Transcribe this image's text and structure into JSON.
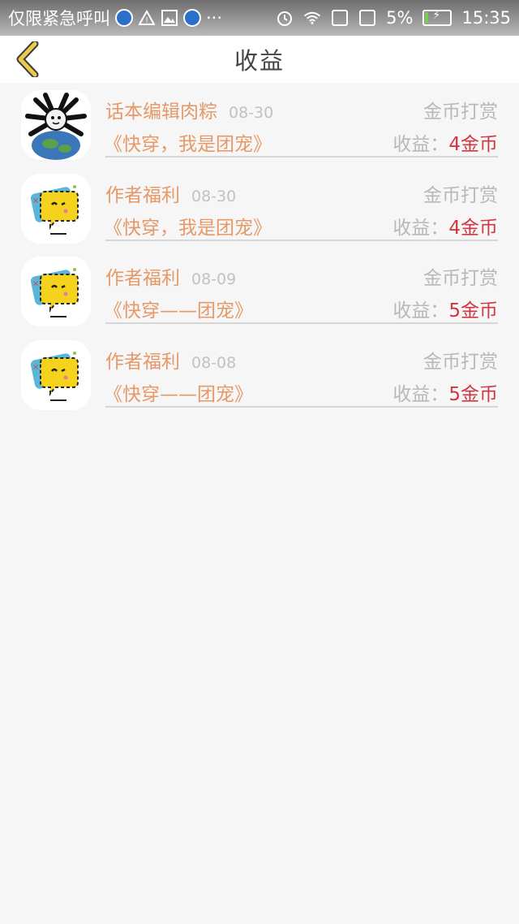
{
  "status_bar": {
    "notification_text": "仅限紧急呼叫",
    "battery_percent": "5%",
    "time": "15:35",
    "more_dots": "···"
  },
  "header": {
    "title": "收益",
    "back_icon": "chevron-left-icon"
  },
  "colors": {
    "accent_orange": "#e69968",
    "earn_red": "#cf3742",
    "muted_gray": "#b8b8b8",
    "back_yellow": "#e8c63a"
  },
  "earnings": [
    {
      "avatar": "spider-meme-avatar",
      "author": "话本编辑肉粽",
      "date": "08-30",
      "type": "金币打赏",
      "book": "《快穿，我是团宠》",
      "earn_label": "收益：",
      "earn_value": "4金币"
    },
    {
      "avatar": "yellow-chat-bubble-avatar",
      "author": "作者福利",
      "date": "08-30",
      "type": "金币打赏",
      "book": "《快穿，我是团宠》",
      "earn_label": "收益：",
      "earn_value": "4金币"
    },
    {
      "avatar": "yellow-chat-bubble-avatar",
      "author": "作者福利",
      "date": "08-09",
      "type": "金币打赏",
      "book": "《快穿——团宠》",
      "earn_label": "收益：",
      "earn_value": "5金币"
    },
    {
      "avatar": "yellow-chat-bubble-avatar",
      "author": "作者福利",
      "date": "08-08",
      "type": "金币打赏",
      "book": "《快穿——团宠》",
      "earn_label": "收益：",
      "earn_value": "5金币"
    }
  ]
}
